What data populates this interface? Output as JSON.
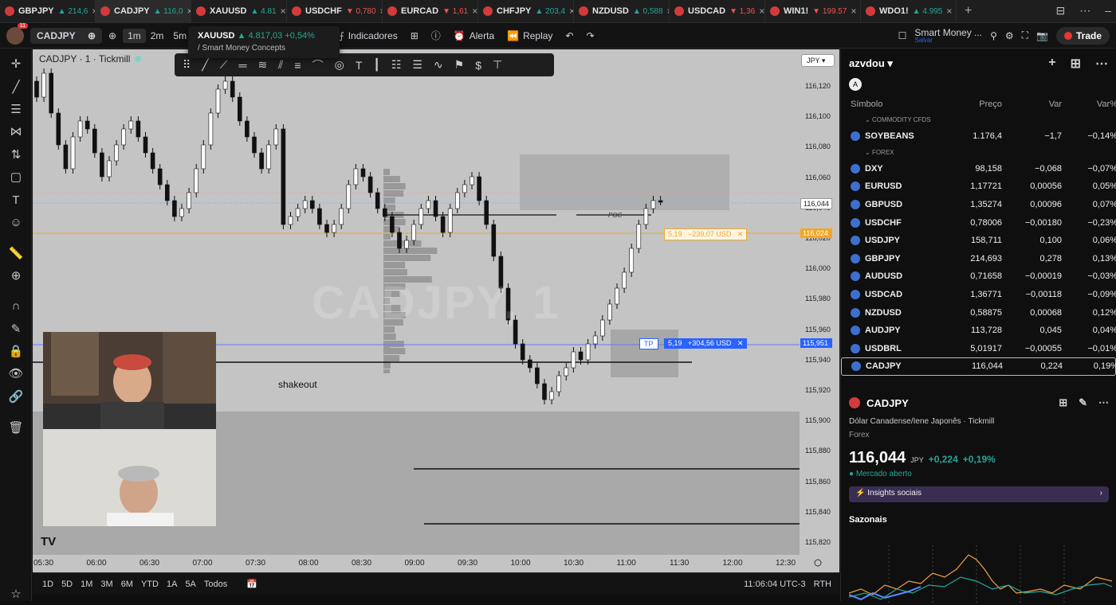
{
  "browser_tabs": [
    {
      "symbol": "GBPJPY",
      "change": "▲ 214,6",
      "dir": "up",
      "active": false
    },
    {
      "symbol": "CADJPY",
      "change": "▲ 116,0",
      "dir": "up",
      "active": true
    },
    {
      "symbol": "XAUUSD",
      "change": "▲ 4.81",
      "dir": "up",
      "active": false
    },
    {
      "symbol": "USDCHF",
      "change": "▼ 0,780",
      "dir": "dn",
      "active": false
    },
    {
      "symbol": "EURCAD",
      "change": "▼ 1,61",
      "dir": "dn",
      "active": false
    },
    {
      "symbol": "CHFJPY",
      "change": "▲ 203,4",
      "dir": "up",
      "active": false
    },
    {
      "symbol": "NZDUSD",
      "change": "▲ 0,588",
      "dir": "up",
      "active": false
    },
    {
      "symbol": "USDCAD",
      "change": "▼ 1,36",
      "dir": "dn",
      "active": false
    },
    {
      "symbol": "WIN1!",
      "change": "▼ 199.57",
      "dir": "dn",
      "active": false
    },
    {
      "symbol": "WDO1!",
      "change": "▲ 4.995",
      "dir": "up",
      "active": false
    }
  ],
  "toolbar": {
    "badge": "11",
    "symbol": "CADJPY",
    "timeframes": [
      "1m",
      "2m",
      "5m"
    ],
    "active_timeframe": "1m",
    "indicators_label": "Indicadores",
    "alert_label": "Alerta",
    "replay_label": "Replay",
    "layout_name": "Smart Money ...",
    "layout_sub": "Salvar",
    "trade_label": "Trade"
  },
  "tooltip": {
    "line1_symbol": "XAUUSD",
    "line1_value": "▲ 4.817,03",
    "line1_change": "+0,54%",
    "line2": "/ Smart Money Concepts"
  },
  "chart": {
    "title": "CADJPY · 1 · Tickmill",
    "currency": "JPY",
    "watermark": "CADJPY, 1",
    "annotation": "shakeout",
    "poc_label": "POC",
    "y_labels": [
      "116,120",
      "116,100",
      "116,080",
      "116,060",
      "116,040",
      "116,020",
      "116,000",
      "115,980",
      "115,960",
      "115,940",
      "115,920",
      "115,900",
      "115,880",
      "115,860",
      "115,840",
      "115,820"
    ],
    "x_labels": [
      "05:30",
      "06:00",
      "06:30",
      "07:00",
      "07:30",
      "08:00",
      "08:30",
      "09:00",
      "09:30",
      "10:00",
      "10:30",
      "11:00",
      "11:30",
      "12:00",
      "12:30"
    ],
    "current_price": "116,044",
    "sl_price": "116,024",
    "tp_price": "115,951",
    "sl_qty": "5,19",
    "sl_pnl": "−239,07 USD",
    "tp_label": "TP",
    "tp_qty": "5,19",
    "tp_pnl": "+304,56 USD"
  },
  "bottombar": {
    "ranges": [
      "1D",
      "5D",
      "1M",
      "3M",
      "6M",
      "YTD",
      "1A",
      "5A",
      "Todos"
    ],
    "clock": "11:06:04 UTC-3",
    "session": "RTH"
  },
  "watchlist": {
    "user": "azvdou",
    "cols": [
      "Símbolo",
      "Preço",
      "Var",
      "Var%"
    ],
    "sections": [
      {
        "name": "COMMODITY CFDS",
        "rows": [
          {
            "symbol": "SOYBEANS",
            "price": "1.176,4",
            "var": "−1,7",
            "varp": "−0,14%",
            "dir": "dn"
          }
        ]
      },
      {
        "name": "FOREX",
        "rows": [
          {
            "symbol": "DXY",
            "price": "98,158",
            "var": "−0,068",
            "varp": "−0,07%",
            "dir": "dn"
          },
          {
            "symbol": "EURUSD",
            "price": "1,17721",
            "var": "0,00056",
            "varp": "0,05%",
            "dir": "up"
          },
          {
            "symbol": "GBPUSD",
            "price": "1,35274",
            "var": "0,00096",
            "varp": "0,07%",
            "dir": "up"
          },
          {
            "symbol": "USDCHF",
            "price": "0,78006",
            "var": "−0,00180",
            "varp": "−0,23%",
            "dir": "dn"
          },
          {
            "symbol": "USDJPY",
            "price": "158,711",
            "var": "0,100",
            "varp": "0,06%",
            "dir": "up"
          },
          {
            "symbol": "GBPJPY",
            "price": "214,693",
            "var": "0,278",
            "varp": "0,13%",
            "dir": "up"
          },
          {
            "symbol": "AUDUSD",
            "price": "0,71658",
            "var": "−0,00019",
            "varp": "−0,03%",
            "dir": "dn"
          },
          {
            "symbol": "USDCAD",
            "price": "1,36771",
            "var": "−0,00118",
            "varp": "−0,09%",
            "dir": "dn"
          },
          {
            "symbol": "NZDUSD",
            "price": "0,58875",
            "var": "0,00068",
            "varp": "0,12%",
            "dir": "up"
          },
          {
            "symbol": "AUDJPY",
            "price": "113,728",
            "var": "0,045",
            "varp": "0,04%",
            "dir": "up"
          },
          {
            "symbol": "USDBRL",
            "price": "5,01917",
            "var": "−0,00055",
            "varp": "−0,01%",
            "dir": "dn"
          },
          {
            "symbol": "CADJPY",
            "price": "116,044",
            "var": "0,224",
            "varp": "0,19%",
            "dir": "up",
            "selected": true
          }
        ]
      }
    ]
  },
  "detail": {
    "symbol": "CADJPY",
    "description": "Dólar Canadense/Iene Japonês · Tickmill",
    "type": "Forex",
    "price": "116,044",
    "currency": "JPY",
    "change": "+0,224",
    "change_pct": "+0,19%",
    "market_status": "● Mercado aberto",
    "insights": "Insights sociais",
    "seasonals": "Sazonais"
  },
  "colors": {
    "up": "#26a69a",
    "down": "#ef5350",
    "accent": "#2962ff",
    "sl": "#f5a623"
  }
}
